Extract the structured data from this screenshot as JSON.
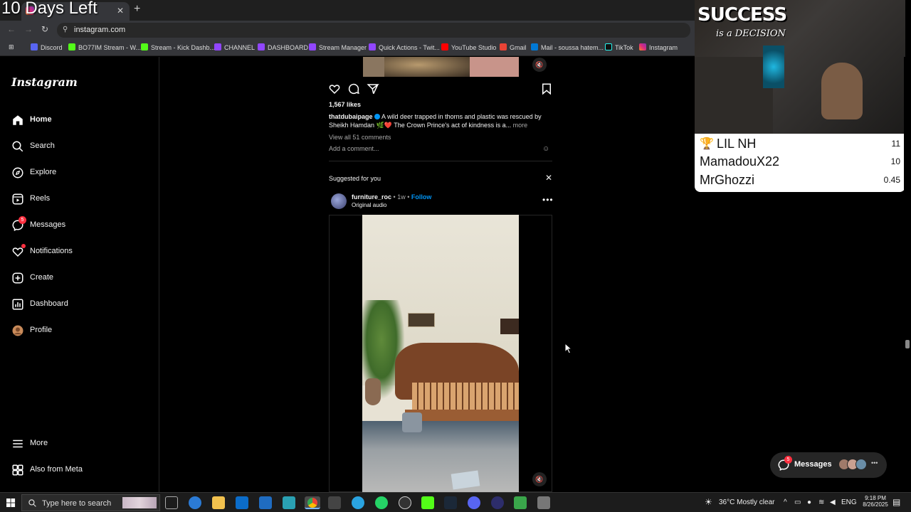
{
  "overlay": {
    "days_left": "10 Days Left",
    "banner_top": "SUCCESS",
    "banner_bottom": "is a DECISION"
  },
  "browser": {
    "url": "instagram.com",
    "bookmarks": [
      "Discord",
      "BO77IM Stream - W...",
      "Stream - Kick Dashb...",
      "CHANNEL",
      "DASHBOARD",
      "Stream Manager",
      "Quick Actions - Twit...",
      "YouTube Studio",
      "Gmail",
      "Mail - soussa hatem...",
      "TikTok",
      "Instagram"
    ]
  },
  "sidebar": {
    "logo": "Instagram",
    "items": [
      {
        "label": "Home",
        "icon": "home-icon"
      },
      {
        "label": "Search",
        "icon": "search-icon"
      },
      {
        "label": "Explore",
        "icon": "compass-icon"
      },
      {
        "label": "Reels",
        "icon": "reels-icon"
      },
      {
        "label": "Messages",
        "icon": "messenger-icon",
        "badge": "5"
      },
      {
        "label": "Notifications",
        "icon": "heart-icon"
      },
      {
        "label": "Create",
        "icon": "plus-square-icon"
      },
      {
        "label": "Dashboard",
        "icon": "chart-icon"
      },
      {
        "label": "Profile",
        "icon": "avatar-icon"
      }
    ],
    "more": "More",
    "also_from_meta": "Also from Meta"
  },
  "post1": {
    "likes": "1,567 likes",
    "author": "thatdubaipage",
    "caption": "A wild deer trapped in thorns and plastic was rescued by Sheikh Hamdan 🌿❤️ The Crown Prince's act of kindness is a...",
    "more": "more",
    "view_comments": "View all 51 comments",
    "add_comment": "Add a comment..."
  },
  "suggested": {
    "title": "Suggested for you",
    "author": "furniture_roc",
    "time": "1w",
    "separator": "•",
    "follow": "Follow",
    "audio": "Original audio"
  },
  "leaderboard": [
    {
      "name": "LIL NH",
      "value": "11"
    },
    {
      "name": "MamadouX22",
      "value": "10"
    },
    {
      "name": "MrGhozzi",
      "value": "0.45"
    }
  ],
  "messages_pill": {
    "label": "Messages",
    "badge": "5"
  },
  "taskbar": {
    "search_placeholder": "Type here to search",
    "weather": "36°C  Mostly clear",
    "lang": "ENG",
    "time": "9:18 PM",
    "date": "8/26/2025"
  },
  "colors": {
    "instagram_blue": "#0095f6",
    "badge_red": "#ff3040"
  }
}
